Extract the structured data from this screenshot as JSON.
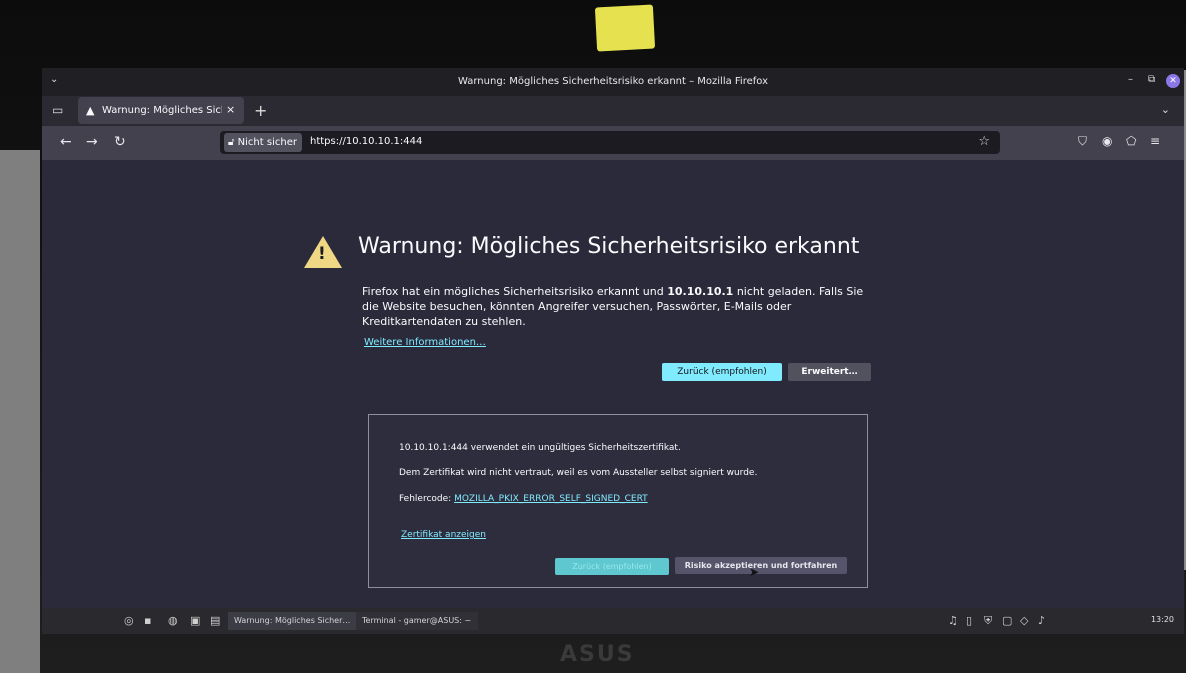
{
  "window": {
    "title": "Warnung: Mögliches Sicherheitsrisiko erkannt – Mozilla Firefox",
    "minimize_glyph": "–",
    "restore_glyph": "⧉",
    "close_glyph": "✕",
    "collapse_glyph": "⌄"
  },
  "tabs": [
    {
      "label": "Warnung: Mögliches Sicherheitsrisiko erkannt",
      "close": "×"
    }
  ],
  "new_tab_glyph": "+",
  "tab_list_glyph": "⌄",
  "navbar": {
    "back": "←",
    "forward": "→",
    "reload": "↻",
    "security_label": "Nicht sicher",
    "url": "https://10.10.10.1:444",
    "bookmark_glyph": "☆",
    "pocket": "⛉",
    "account": "◉",
    "extensions": "⬠",
    "menu": "≡"
  },
  "error_page": {
    "heading": "Warnung: Mögliches Sicherheitsrisiko erkannt",
    "desc_part1": "Firefox hat ein mögliches Sicherheitsrisiko erkannt und ",
    "desc_host": "10.10.10.1",
    "desc_part2": " nicht geladen. Falls Sie die Website besuchen, könnten Angreifer versuchen, Passwörter, E-Mails oder Kreditkartendaten zu stehlen.",
    "learn_more": "Weitere Informationen…",
    "back_button": "Zurück (empfohlen)",
    "advanced_button": "Erweitert…",
    "advanced_panel": {
      "line1": "10.10.10.1:444 verwendet ein ungültiges Sicherheitszertifikat.",
      "line2": "Dem Zertifikat wird nicht vertraut, weil es vom Aussteller selbst signiert wurde.",
      "error_label": "Fehlercode: ",
      "error_code": "MOZILLA_PKIX_ERROR_SELF_SIGNED_CERT",
      "view_cert": "Zertifikat anzeigen",
      "back_button": "Zurück (empfohlen)",
      "accept_button": "Risiko akzeptieren und fortfahren"
    }
  },
  "taskbar": {
    "tasks": [
      "Warnung: Mögliches Sicher…",
      "Terminal - gamer@ASUS: ~"
    ],
    "clock": "13:20"
  },
  "laptop_logo": "ASUS",
  "colors": {
    "accent": "#80ebff",
    "warning": "#f0d784",
    "page_bg": "#2a2a3a"
  }
}
